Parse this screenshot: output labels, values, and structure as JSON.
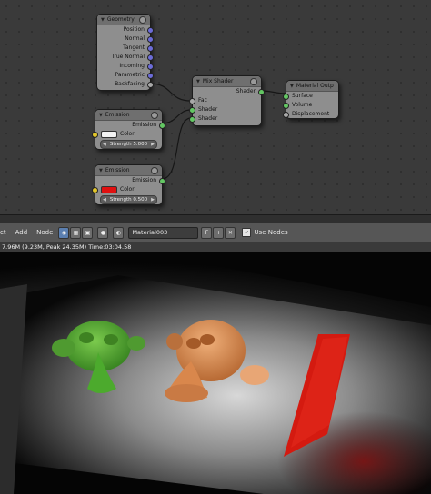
{
  "node_editor": {
    "geometry_node": {
      "title": "Geometry",
      "outputs": [
        "Position",
        "Normal",
        "Tangent",
        "True Normal",
        "Incoming",
        "Parametric",
        "Backfacing"
      ]
    },
    "mix_shader_node": {
      "title": "Mix Shader",
      "output": "Shader",
      "inputs": [
        "Fac",
        "Shader",
        "Shader"
      ]
    },
    "material_output_node": {
      "title": "Material Outp",
      "inputs": [
        "Surface",
        "Volume",
        "Displacement"
      ]
    },
    "emission_node_1": {
      "title": "Emission",
      "output": "Emission",
      "color_label": "Color",
      "color": "#f4f4f4",
      "strength_label": "Strength 5.000"
    },
    "emission_node_2": {
      "title": "Emission",
      "output": "Emission",
      "color_label": "Color",
      "color": "#e01010",
      "strength_label": "Strength 0.500"
    }
  },
  "header": {
    "menus": [
      "Add",
      "Node"
    ],
    "clipped_menu": "ct",
    "material_name": "Material003",
    "fake_user_label": "F",
    "use_nodes_label": "Use Nodes",
    "use_nodes_checked": true
  },
  "render": {
    "status": "7.96M (9.23M, Peak 24.35M) Time:03:04.58",
    "colors": {
      "green_monkey": "#5fb33a",
      "orange_monkey": "#e0945a",
      "red_plane": "#d41a10",
      "floor": "#c9c9c9"
    }
  }
}
